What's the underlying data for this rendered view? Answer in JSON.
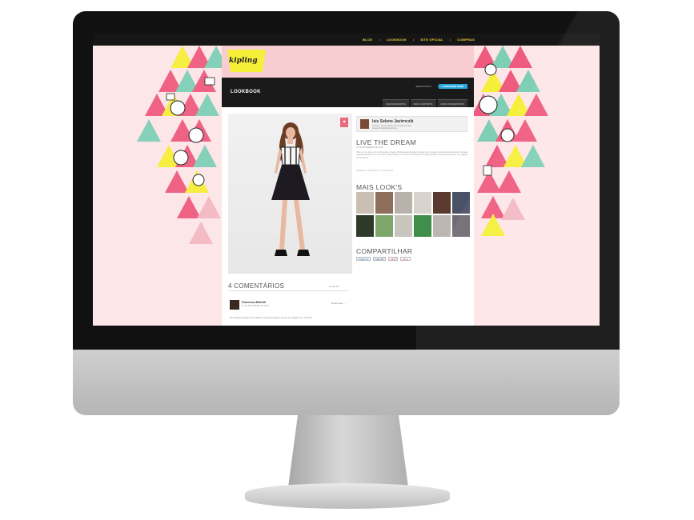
{
  "topnav": {
    "items": [
      "BLOG",
      "LOOKBOOK",
      "SITE OFICIAL",
      "COMPRAS"
    ]
  },
  "logo": {
    "text": "kipling"
  },
  "panel": {
    "title": "LOOKBOOK",
    "links": [
      "SEND POSTS",
      "LOGIN"
    ],
    "send_button": "SUBSCRIBE HERE",
    "tabs": [
      "MAIS RECENTES",
      "MAIS CURTIDOS",
      "MAIS COMENTADOS"
    ]
  },
  "author": {
    "name": "Isis Selene Javirnczik",
    "meta1": "20 anos · Porto Alegre, Rio Grande do Sul",
    "meta2": "isisjavirnczik@hotmail.com"
  },
  "look": {
    "title": "LIVE THE DREAM",
    "date": "10 DE FEVEREIRO DE 2012",
    "description": "Proin ac nisi purus, id condimentum magna. Pellentesque feugiat nisl eget enim congue at molestie tellus dictum. Aenean vulputate lobortis nisl, vel mattis massa. Etiam in orci sed nisl sollicitudin fringilla. Nullam cursus lacinia lacus, non sagittis orci lacinia at.",
    "footer": "Postado por Isis Selene · 4 comentários"
  },
  "more_looks": {
    "title": "MAIS LOOK'S"
  },
  "share": {
    "title": "COMPARTILHAR",
    "buttons": [
      {
        "label": "Tweet",
        "count": "11"
      },
      {
        "label": "Like",
        "count": "38"
      },
      {
        "label": "+1",
        "count": "3"
      },
      {
        "label": "Pin it",
        "count": ""
      }
    ]
  },
  "comments": {
    "title": "4 COMENTÁRIOS",
    "link": "comentar →",
    "items": [
      {
        "name": "Francesca Michelli",
        "date": "10 DE FEVEREIRO DE 2012",
        "reply": "Responder →",
        "text": "Sei lauditus feugiat urna. Nullam maecenas aliquet ipsum nec sagittis orci. Thanks!"
      }
    ]
  },
  "colors": {
    "page_bg": "#fde6e8",
    "pink": "#ef5b7f",
    "mint": "#7fcfb7",
    "yellow": "#f6ef3a",
    "accent_blue": "#2aa8e0",
    "nav_yellow": "#f3d23a"
  }
}
